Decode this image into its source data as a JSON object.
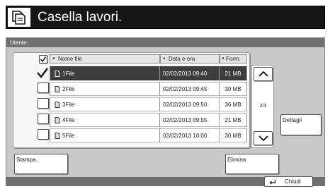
{
  "header": {
    "title": "Casella lavori."
  },
  "panel": {
    "user_label": "Utente:"
  },
  "table": {
    "columns": {
      "name": "Nome file",
      "date": "Data e ora",
      "size": "Form."
    },
    "rows": [
      {
        "name": "1File",
        "date": "02/02/2013 09:40",
        "size": "21 MB",
        "selected": true
      },
      {
        "name": "2File",
        "date": "02/02/2013 09:45",
        "size": "30 MB",
        "selected": false
      },
      {
        "name": "3File",
        "date": "02/02/2013 09:50",
        "size": "36 MB",
        "selected": false
      },
      {
        "name": "4File",
        "date": "02/02/2013 09:55",
        "size": "21 MB",
        "selected": false
      },
      {
        "name": "5File",
        "date": "02/02/2013 10:00",
        "size": "30 MB",
        "selected": false
      }
    ]
  },
  "pager": {
    "page": "2/3"
  },
  "buttons": {
    "details": "Dettagli",
    "print": "Stampa",
    "delete": "Elimina",
    "close": "Chiudi"
  },
  "icons": {
    "header": "document-box-icon",
    "file": "document-icon",
    "up": "chevron-up-icon",
    "down": "chevron-down-icon",
    "close": "return-arrow-icon",
    "sort": "sort-triangle-icon"
  },
  "colors": {
    "header_bg": "#161616",
    "frame_bg": "#c9c9c9",
    "bar_bg": "#6f6f6f",
    "selected_row": "#3d3d3d"
  }
}
